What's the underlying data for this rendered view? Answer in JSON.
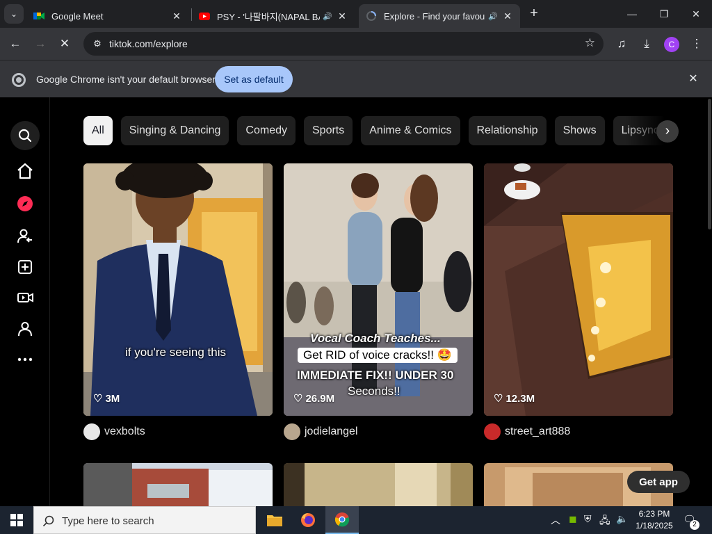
{
  "browser": {
    "tabs": [
      {
        "title": "Google Meet",
        "audio": false
      },
      {
        "title": "PSY - '나팔바지(NAPAL BA",
        "audio": true
      },
      {
        "title": "Explore - Find your favourite",
        "audio": true
      }
    ],
    "url": "tiktok.com/explore",
    "profile_initial": "C",
    "infobar": {
      "message": "Google Chrome isn't your default browser",
      "button": "Set as default"
    }
  },
  "tiktok": {
    "categories": [
      "All",
      "Singing & Dancing",
      "Comedy",
      "Sports",
      "Anime & Comics",
      "Relationship",
      "Shows",
      "Lipsync"
    ],
    "active_category": "All",
    "videos": [
      {
        "likes": "3M",
        "author": "vexbolts",
        "caption": "if you're seeing this"
      },
      {
        "likes": "26.9M",
        "author": "jodielangel",
        "captions": [
          "Vocal Coach Teaches...",
          "Get RID of voice cracks!! 🤩",
          "IMMEDIATE FIX!! UNDER 30",
          "Seconds!!"
        ]
      },
      {
        "likes": "12.3M",
        "author": "street_art888"
      }
    ],
    "get_app": "Get app"
  },
  "taskbar": {
    "search_placeholder": "Type here to search",
    "time": "6:23 PM",
    "date": "1/18/2025",
    "notification_count": "2"
  }
}
